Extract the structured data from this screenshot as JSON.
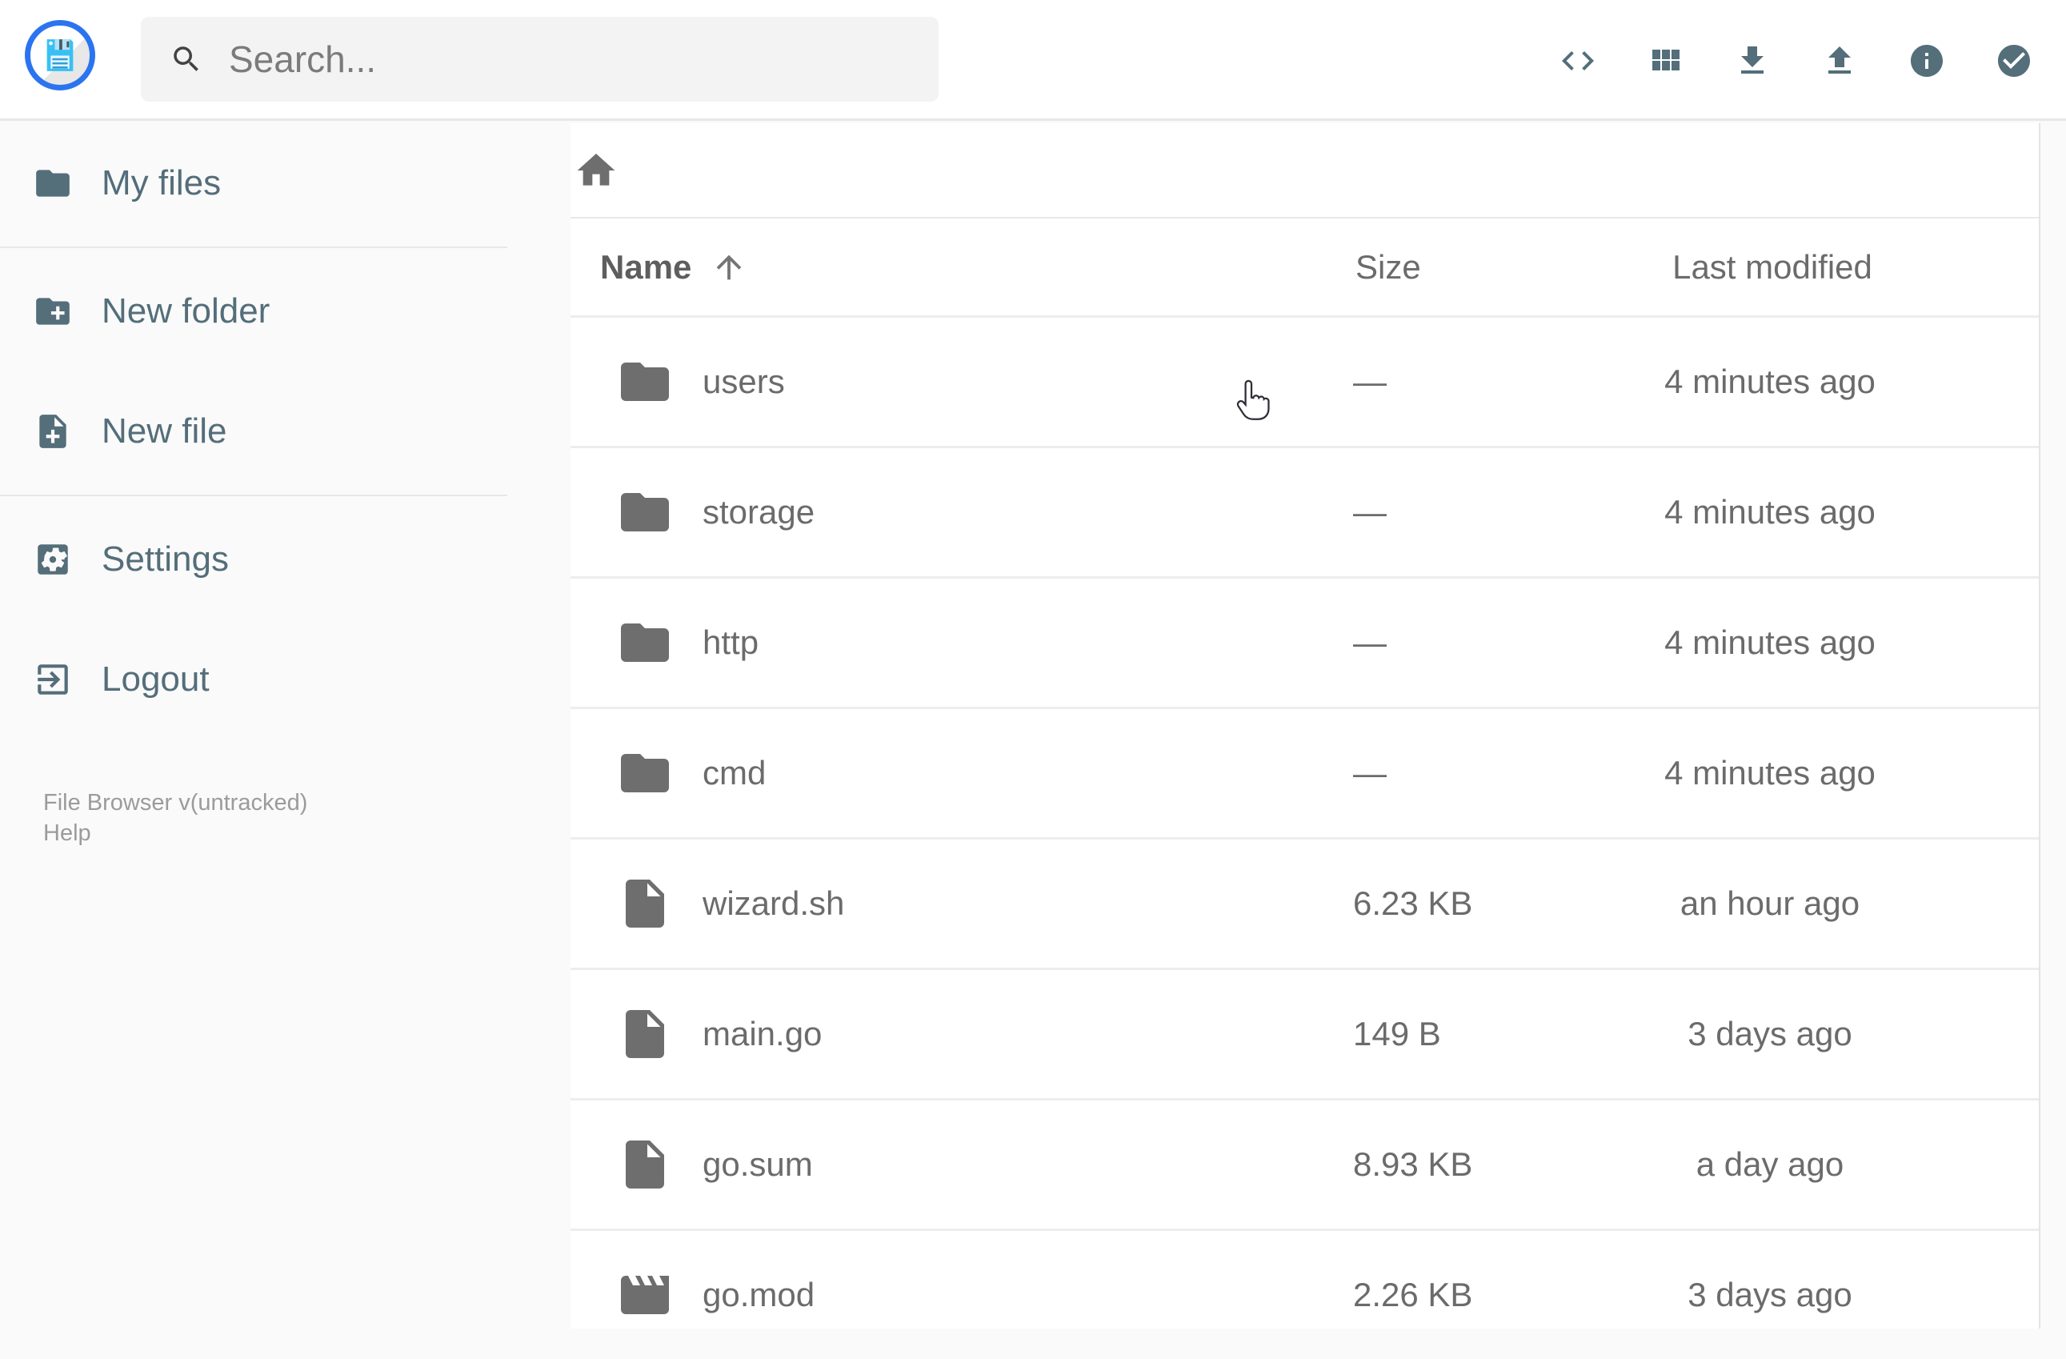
{
  "header": {
    "logo": {
      "icon": "floppy-disk-logo"
    },
    "search": {
      "placeholder": "Search..."
    },
    "actions": [
      {
        "name": "raw-view",
        "icon": "code-icon"
      },
      {
        "name": "switch-view",
        "icon": "grid-view-icon"
      },
      {
        "name": "download",
        "icon": "download-icon"
      },
      {
        "name": "upload",
        "icon": "upload-icon"
      },
      {
        "name": "info",
        "icon": "info-icon"
      },
      {
        "name": "select-multiple",
        "icon": "check-circle-icon"
      }
    ]
  },
  "sidebar": {
    "items": [
      {
        "label": "My files",
        "icon": "folder-icon",
        "divider_after": true
      },
      {
        "label": "New folder",
        "icon": "folder-plus-icon",
        "divider_after": false
      },
      {
        "label": "New file",
        "icon": "file-plus-icon",
        "divider_after": true
      },
      {
        "label": "Settings",
        "icon": "settings-icon",
        "divider_after": false
      },
      {
        "label": "Logout",
        "icon": "logout-icon",
        "divider_after": false
      }
    ],
    "footer": {
      "version": "File Browser v(untracked)",
      "help": "Help"
    }
  },
  "main": {
    "breadcrumb": {
      "icon": "home-icon"
    },
    "table": {
      "columns": [
        {
          "label": "Name",
          "sorted": "asc"
        },
        {
          "label": "Size"
        },
        {
          "label": "Last modified"
        }
      ],
      "rows": [
        {
          "name": "users",
          "type": "folder",
          "icon": "folder-icon",
          "size": "—",
          "modified": "4 minutes ago"
        },
        {
          "name": "storage",
          "type": "folder",
          "icon": "folder-icon",
          "size": "—",
          "modified": "4 minutes ago"
        },
        {
          "name": "http",
          "type": "folder",
          "icon": "folder-icon",
          "size": "—",
          "modified": "4 minutes ago"
        },
        {
          "name": "cmd",
          "type": "folder",
          "icon": "folder-icon",
          "size": "—",
          "modified": "4 minutes ago"
        },
        {
          "name": "wizard.sh",
          "type": "file",
          "icon": "file-icon",
          "size": "6.23 KB",
          "modified": "an hour ago"
        },
        {
          "name": "main.go",
          "type": "file",
          "icon": "file-icon",
          "size": "149 B",
          "modified": "3 days ago"
        },
        {
          "name": "go.sum",
          "type": "file",
          "icon": "file-icon",
          "size": "8.93 KB",
          "modified": "a day ago"
        },
        {
          "name": "go.mod",
          "type": "file",
          "icon": "movie-icon",
          "size": "2.26 KB",
          "modified": "3 days ago"
        }
      ]
    }
  },
  "cursor": {
    "type": "hand-pointer"
  },
  "colors": {
    "brand_blue": "#2b74ef",
    "floppy_cyan": "#38c0f5",
    "slate_icon": "#546e7a",
    "row_gray": "#6b6b6b",
    "background": "#fafafa"
  }
}
